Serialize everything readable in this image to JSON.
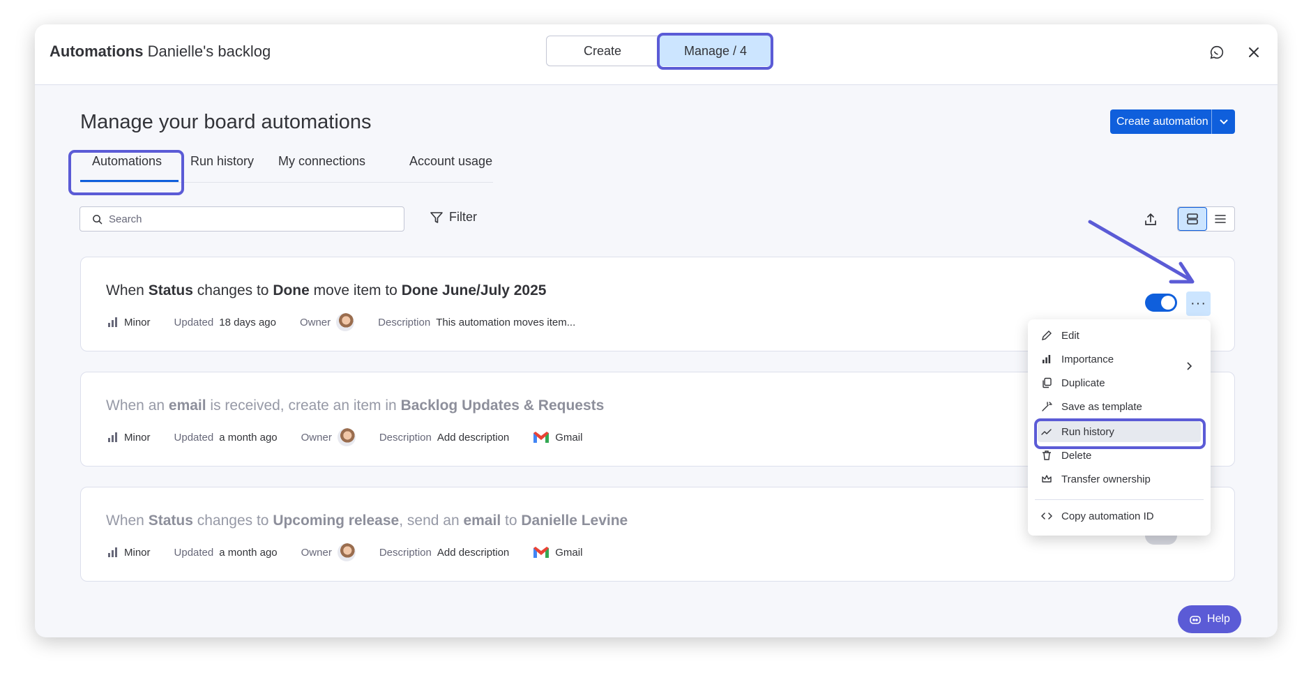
{
  "header": {
    "title_bold": "Automations",
    "title_rest": "Danielle's backlog",
    "seg_create": "Create",
    "seg_manage": "Manage / 4",
    "icons": {
      "feedback": "chat-icon",
      "close": "close-icon"
    }
  },
  "page": {
    "title": "Manage your board automations",
    "create_button": "Create automation"
  },
  "tabs": [
    {
      "label": "Automations",
      "active": true
    },
    {
      "label": "Run history"
    },
    {
      "label": "My connections"
    },
    {
      "label": "Account usage"
    }
  ],
  "toolbar": {
    "search_placeholder": "Search",
    "filter_label": "Filter"
  },
  "cards": [
    {
      "rule": [
        {
          "t": "When "
        },
        {
          "t": "Status",
          "b": true
        },
        {
          "t": " changes to "
        },
        {
          "t": "Done",
          "b": true
        },
        {
          "t": " move item to "
        },
        {
          "t": "Done June/July 2025",
          "b": true
        }
      ],
      "importance": "Minor",
      "updated_label": "Updated",
      "updated_value": "18 days ago",
      "owner_label": "Owner",
      "description_label": "Description",
      "description_value": "This automation moves item...",
      "enabled": true
    },
    {
      "rule": [
        {
          "t": "When an "
        },
        {
          "t": "email",
          "b": true
        },
        {
          "t": " is received, create an item in "
        },
        {
          "t": "Backlog Updates & Requests",
          "b": true
        }
      ],
      "importance": "Minor",
      "updated_label": "Updated",
      "updated_value": "a month ago",
      "owner_label": "Owner",
      "description_label": "Description",
      "description_value": "Add description",
      "integration": "Gmail",
      "enabled": false
    },
    {
      "rule": [
        {
          "t": "When "
        },
        {
          "t": "Status",
          "b": true
        },
        {
          "t": " changes to "
        },
        {
          "t": "Upcoming release",
          "b": true
        },
        {
          "t": ", send an "
        },
        {
          "t": "email",
          "b": true
        },
        {
          "t": " to "
        },
        {
          "t": "Danielle Levine",
          "b": true
        }
      ],
      "importance": "Minor",
      "updated_label": "Updated",
      "updated_value": "a month ago",
      "owner_label": "Owner",
      "description_label": "Description",
      "description_value": "Add description",
      "integration": "Gmail",
      "enabled": false
    }
  ],
  "menu": {
    "items": [
      "Edit",
      "Importance",
      "Duplicate",
      "Save as template",
      "Run history",
      "Delete",
      "Transfer ownership",
      "Copy automation ID"
    ],
    "selected": "Run history"
  },
  "more_button": "···",
  "help_label": "Help",
  "colors": {
    "primary": "#0f5fdc",
    "selected_bg": "#cce5ff",
    "highlight": "#5b5bd6",
    "gmail_red": "#ea4335"
  }
}
